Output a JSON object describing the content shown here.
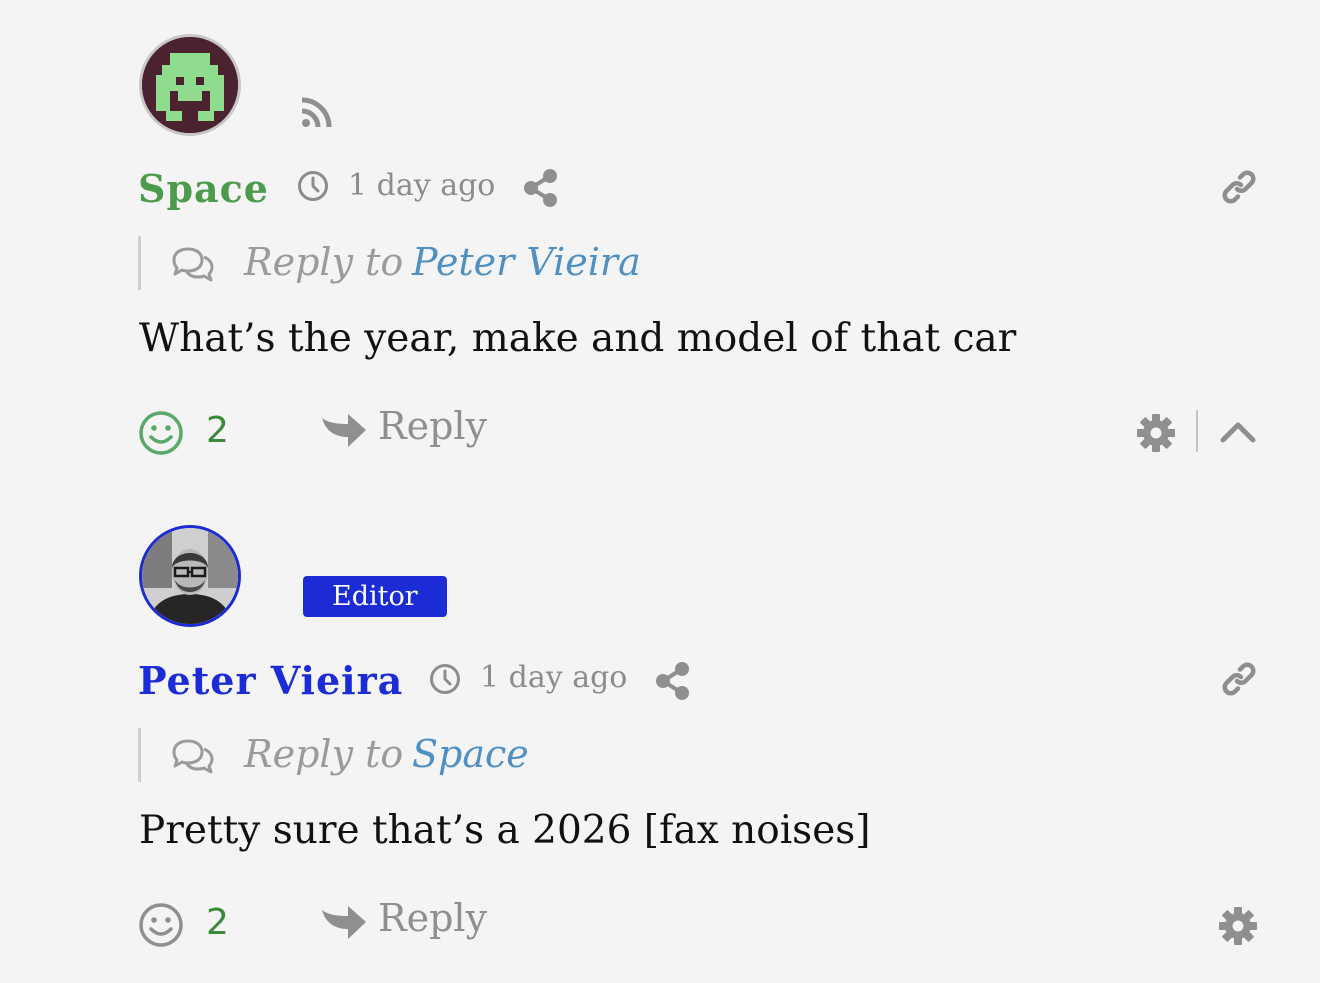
{
  "comments": [
    {
      "author": "Space",
      "author_color": "#4c9a4c",
      "timestamp": "1 day ago",
      "reply_prefix": "Reply to",
      "reply_to": "Peter Vieira",
      "body": "What’s the year, make and model of that car",
      "reaction_count": "2",
      "reply_label": "Reply",
      "icons": [
        "rss-icon",
        "clock-icon",
        "share-icon",
        "link-icon",
        "chat-bubbles-icon",
        "smile-icon",
        "reply-arrow-icon",
        "gear-icon",
        "chevron-up-icon"
      ]
    },
    {
      "author": "Peter Vieira",
      "author_color": "#1b2bd6",
      "badge": "Editor",
      "timestamp": "1 day ago",
      "reply_prefix": "Reply to",
      "reply_to": "Space",
      "body": "Pretty sure that’s a 2026 [fax noises]",
      "reaction_count": "2",
      "reply_label": "Reply",
      "icons": [
        "clock-icon",
        "share-icon",
        "link-icon",
        "chat-bubbles-icon",
        "smile-icon",
        "reply-arrow-icon",
        "gear-icon"
      ]
    }
  ],
  "colors": {
    "background": "#f4f4f4",
    "link": "#4f8fc2",
    "count_green": "#3a8a3a",
    "editor_badge": "#1b2bd6"
  }
}
